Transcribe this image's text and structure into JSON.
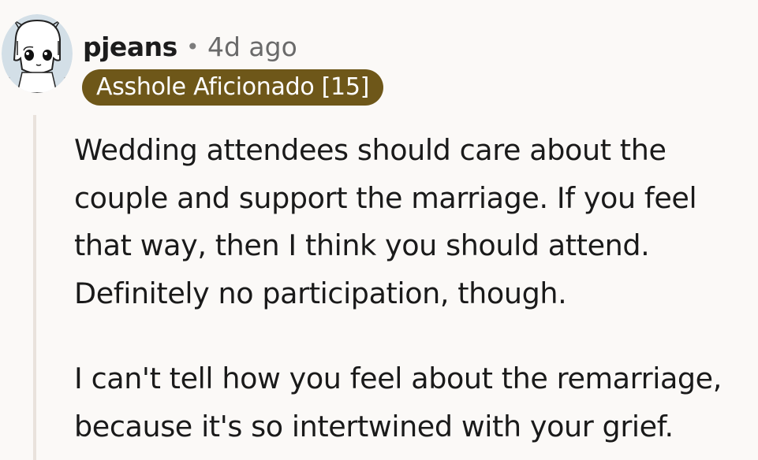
{
  "comment": {
    "author": "pjeans",
    "separator": "•",
    "time_ago": "4d ago",
    "flair": "Asshole Aficionado [15]",
    "paragraphs": [
      "Wedding attendees should care about the\ncouple and support the marriage. If you feel\nthat way, then I think you should attend.\nDefinitely no participation, though.",
      "I can't tell how you feel about the remarriage,\nbecause it's so intertwined with your grief."
    ]
  },
  "colors": {
    "background": "#fbf9f7",
    "flair_bg": "#6e5719",
    "flair_text": "#ffffff",
    "thread_line": "#e9e2dc"
  },
  "icons": {
    "avatar": "user-avatar-drawing"
  }
}
